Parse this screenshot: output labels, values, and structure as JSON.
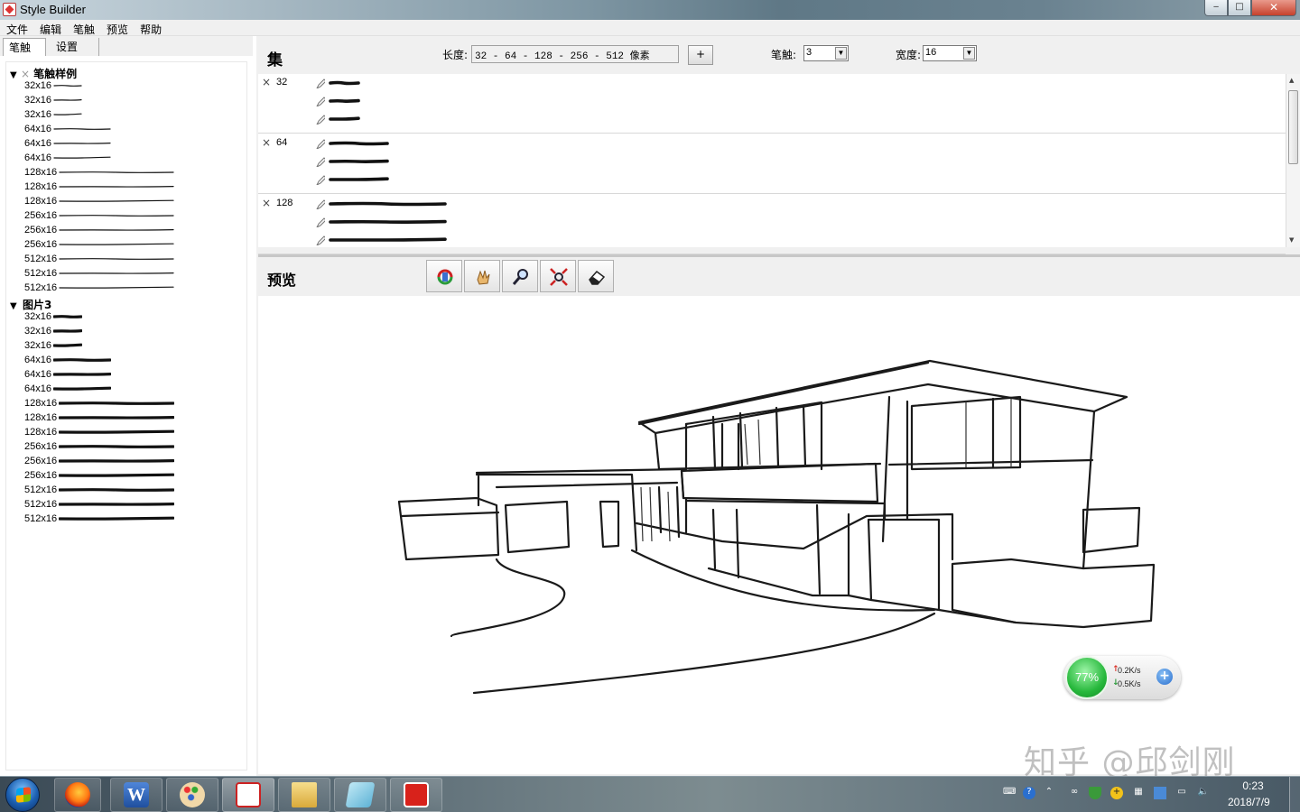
{
  "window": {
    "title": "Style Builder",
    "controls": {
      "minimize": "‒",
      "maximize": "□",
      "close": "✕"
    }
  },
  "menu": [
    "文件",
    "编辑",
    "笔触",
    "预览",
    "帮助"
  ],
  "left_tabs": [
    "笔触",
    "设置"
  ],
  "tree": {
    "groups": [
      {
        "name": "笔触样例",
        "items": [
          "32x16",
          "32x16",
          "32x16",
          "64x16",
          "64x16",
          "64x16",
          "128x16",
          "128x16",
          "128x16",
          "256x16",
          "256x16",
          "256x16",
          "512x16",
          "512x16",
          "512x16"
        ]
      },
      {
        "name": "图片3",
        "items": [
          "32x16",
          "32x16",
          "32x16",
          "64x16",
          "64x16",
          "64x16",
          "128x16",
          "128x16",
          "128x16",
          "256x16",
          "256x16",
          "256x16",
          "512x16",
          "512x16",
          "512x16"
        ]
      }
    ]
  },
  "set_panel": {
    "title": "集",
    "length_label": "长度:",
    "length_value": "32 - 64 - 128 - 256 - 512 像素",
    "add_label": "+",
    "brush_label": "笔触:",
    "brush_value": "3",
    "width_label": "宽度:",
    "width_value": "16",
    "sets": [
      {
        "x": "×",
        "size": "32"
      },
      {
        "x": "×",
        "size": "64"
      },
      {
        "x": "×",
        "size": "128"
      }
    ]
  },
  "preview": {
    "title": "预览",
    "tools": [
      "orbit-icon",
      "pan-icon",
      "zoom-icon",
      "zoom-extents-icon",
      "eraser-icon"
    ]
  },
  "net_widget": {
    "cpu_percent": "77%",
    "upload": "0.2K/s",
    "download": "0.5K/s"
  },
  "watermark": "知乎 @邱剑刚",
  "taskbar": {
    "apps": [
      "firefox-icon",
      "word-icon",
      "paint-icon",
      "style-builder-icon",
      "explorer-icon",
      "notepad-icon",
      "sketchup-icon"
    ],
    "time": "0:23",
    "date": "2018/7/9"
  },
  "colors": {
    "cpu_green": "#27b83c",
    "close_red": "#c6412c"
  }
}
